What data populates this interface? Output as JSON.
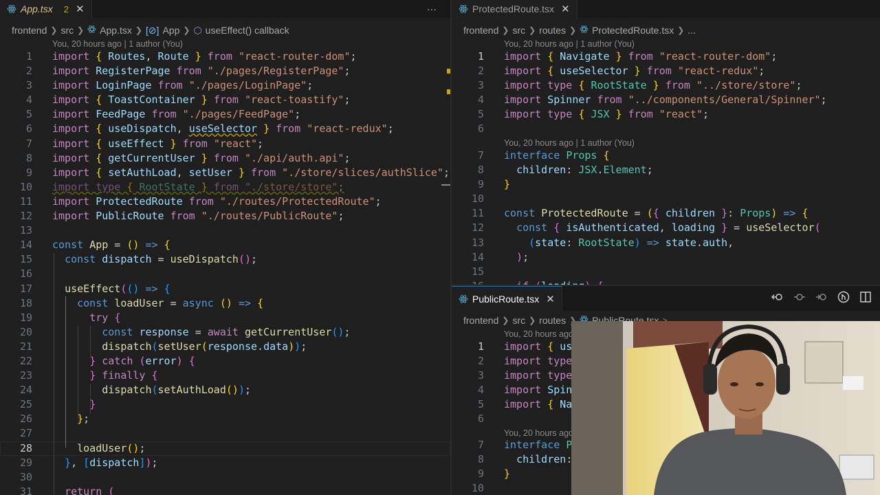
{
  "left": {
    "tab": {
      "name": "App.tsx",
      "badge": "2",
      "close": "✕"
    },
    "more": "···",
    "breadcrumb": [
      "frontend",
      "src",
      "App.tsx",
      "App",
      "useEffect() callback"
    ],
    "blame": "You, 20 hours ago | 1 author (You)"
  },
  "right_top": {
    "tab": {
      "name": "ProtectedRoute.tsx",
      "close": "✕"
    },
    "breadcrumb": [
      "frontend",
      "src",
      "routes",
      "ProtectedRoute.tsx",
      "..."
    ],
    "blame1": "You, 20 hours ago | 1 author (You)",
    "blame2": "You, 20 hours ago | 1 author (You)"
  },
  "right_bottom": {
    "tab": {
      "name": "PublicRoute.tsx",
      "close": "✕"
    },
    "breadcrumb": [
      "frontend",
      "src",
      "routes",
      "PublicRoute.tsx",
      ">"
    ],
    "blame1": "You, 20 hours ago | 1 author (You)",
    "blame2": "You, 20 hours ago"
  },
  "icons": [
    "react-icon",
    "go-back-icon",
    "go-forward-icon",
    "git-compare-icon",
    "split-editor-icon"
  ],
  "colors": {
    "bg": "#1f1f1f",
    "keyword": "#c586c0",
    "string": "#ce9178",
    "function": "#dcdcaa",
    "variable": "#9cdcfe",
    "type": "#4ec9b0"
  }
}
